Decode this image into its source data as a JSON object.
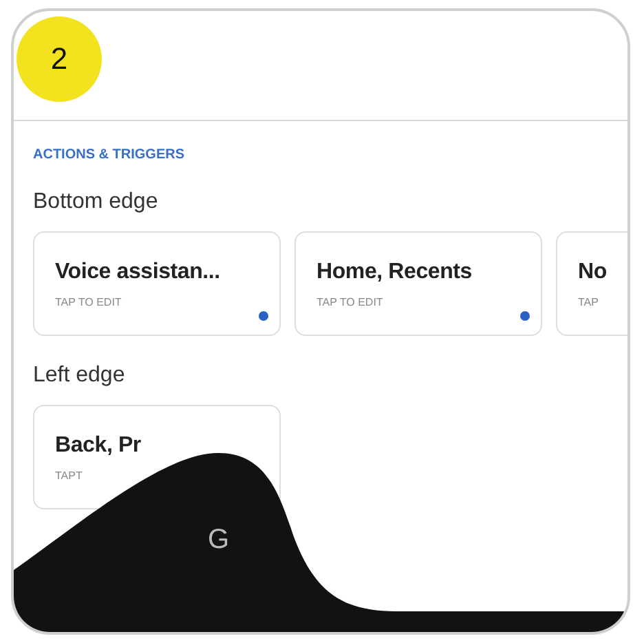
{
  "step_badge": "2",
  "section_label": "ACTIONS & TRIGGERS",
  "groups": [
    {
      "title": "Bottom edge",
      "cards": [
        {
          "title": "Voice assistan...",
          "subtitle": "TAP TO EDIT",
          "indicator": true
        },
        {
          "title": "Home, Recents",
          "subtitle": "TAP TO EDIT",
          "indicator": true
        },
        {
          "title": "No",
          "subtitle": "TAP"
        }
      ]
    },
    {
      "title": "Left edge",
      "cards": [
        {
          "title": "Back, Pr",
          "subtitle": "TAPT"
        }
      ]
    }
  ],
  "overlay_letter": "G"
}
